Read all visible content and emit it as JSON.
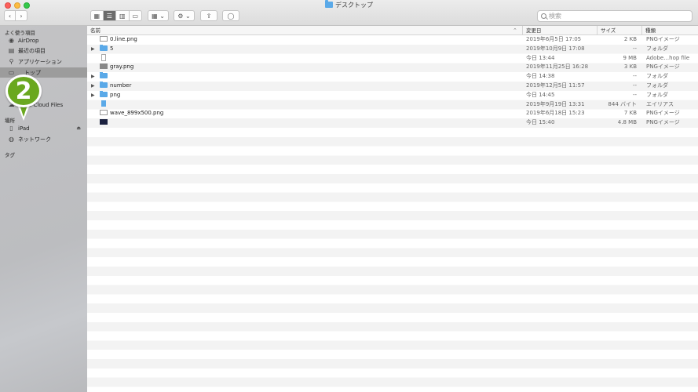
{
  "window": {
    "title": "デスクトップ"
  },
  "toolbar": {
    "back": "‹",
    "forward": "›",
    "view_icons": "▦",
    "view_list": "☰",
    "view_columns": "▥",
    "view_gallery": "▭",
    "group": "▦ ⌄",
    "action": "⚙ ⌄",
    "share": "⇪",
    "tag": "◯",
    "search_placeholder": "検索"
  },
  "sidebar": {
    "favorites_header": "よく使う項目",
    "favorites": [
      {
        "label": "AirDrop",
        "icon": "airdrop-icon",
        "glyph": "◉"
      },
      {
        "label": "最近の項目",
        "icon": "recents-icon",
        "glyph": "▤"
      },
      {
        "label": "アプリケーション",
        "icon": "applications-icon",
        "glyph": "⚲"
      },
      {
        "label": "トップ",
        "icon": "desktop-icon",
        "glyph": "▭"
      },
      {
        "label": "ド",
        "icon": "downloads-icon",
        "glyph": "⬇"
      },
      {
        "label": "e Cloud Files",
        "icon": "cloud-icon",
        "glyph": "☁"
      }
    ],
    "locations_header": "場所",
    "locations": [
      {
        "label": "iPad",
        "icon": "ipad-icon",
        "glyph": "▯",
        "eject": "⏏"
      },
      {
        "label": "ネットワーク",
        "icon": "network-icon",
        "glyph": "◍"
      }
    ],
    "tags_header": "タグ"
  },
  "badge": {
    "number": "2"
  },
  "columns": {
    "name": "名前",
    "date": "変更日",
    "size": "サイズ",
    "kind": "種類",
    "sort_indicator": "⌃"
  },
  "files": [
    {
      "name": "0.line.png",
      "date": "2019年6月5日 17:05",
      "size": "2 KB",
      "kind": "PNGイメージ",
      "icon": "png",
      "disclosure": ""
    },
    {
      "name": "5",
      "date": "2019年10月9日 17:08",
      "size": "--",
      "kind": "フォルダ",
      "icon": "folder",
      "disclosure": "▶"
    },
    {
      "name": "",
      "date": "今日 13:44",
      "size": "9 MB",
      "kind": "Adobe…hop file",
      "icon": "doc",
      "disclosure": ""
    },
    {
      "name": "gray.png",
      "date": "2019年11月25日 16:28",
      "size": "3 KB",
      "kind": "PNGイメージ",
      "icon": "gray",
      "disclosure": ""
    },
    {
      "name": "",
      "date": "今日 14:38",
      "size": "--",
      "kind": "フォルダ",
      "icon": "folder",
      "disclosure": "▶"
    },
    {
      "name": "number",
      "date": "2019年12月5日 11:57",
      "size": "--",
      "kind": "フォルダ",
      "icon": "folder",
      "disclosure": "▶"
    },
    {
      "name": "png",
      "date": "今日 14:45",
      "size": "--",
      "kind": "フォルダ",
      "icon": "folder",
      "disclosure": "▶"
    },
    {
      "name": "",
      "date": "2019年9月19日 13:31",
      "size": "844 バイト",
      "kind": "エイリアス",
      "icon": "alias",
      "disclosure": ""
    },
    {
      "name": "wave_899x500.png",
      "date": "2019年6月18日 15:23",
      "size": "7 KB",
      "kind": "PNGイメージ",
      "icon": "png",
      "disclosure": ""
    },
    {
      "name": "",
      "date": "今日 15:40",
      "size": "4.8 MB",
      "kind": "PNGイメージ",
      "icon": "dark",
      "disclosure": ""
    }
  ]
}
